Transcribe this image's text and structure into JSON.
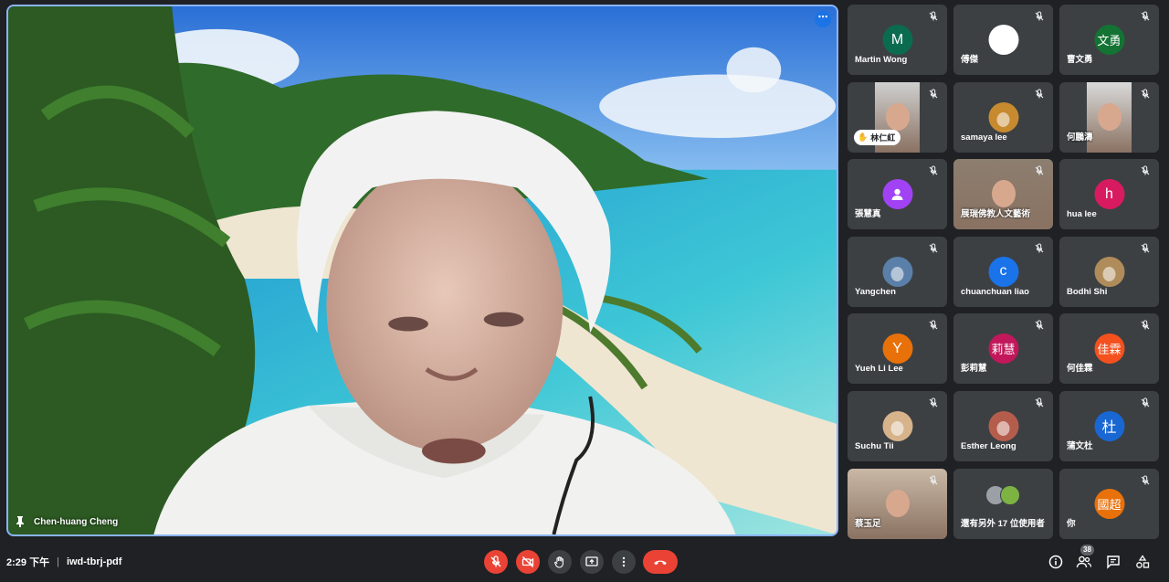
{
  "main": {
    "speaker_name": "Chen-huang Cheng"
  },
  "participants": [
    {
      "name": "Martin Wong",
      "initial": "M",
      "color": "#0b6b4f",
      "type": "initial"
    },
    {
      "name": "傅傑",
      "initial": "",
      "color": "#ffffff",
      "type": "photo-avatar"
    },
    {
      "name": "曹文勇",
      "initial": "文勇",
      "color": "#137333",
      "type": "initial"
    },
    {
      "name": "林仁紅",
      "initial": "",
      "color": "#cfcfcf",
      "type": "video",
      "hand_raised": true
    },
    {
      "name": "samaya lee",
      "initial": "",
      "color": "#c78a2f",
      "type": "photo-avatar"
    },
    {
      "name": "何鵬濤",
      "initial": "",
      "color": "#d9d9d9",
      "type": "video"
    },
    {
      "name": "張慧真",
      "initial": "",
      "color": "#a142f4",
      "type": "person-icon"
    },
    {
      "name": "展瑞佛教人文藝術",
      "initial": "",
      "color": "#8c7e6f",
      "type": "video"
    },
    {
      "name": "hua lee",
      "initial": "h",
      "color": "#d81b60",
      "type": "initial"
    },
    {
      "name": "Yangchen",
      "initial": "",
      "color": "#5a7fa8",
      "type": "photo-avatar"
    },
    {
      "name": "chuanchuan liao",
      "initial": "c",
      "color": "#1a73e8",
      "type": "initial"
    },
    {
      "name": "Bodhi Shi",
      "initial": "",
      "color": "#b08c5a",
      "type": "photo-avatar"
    },
    {
      "name": "Yueh Li Lee",
      "initial": "Y",
      "color": "#e8710a",
      "type": "initial"
    },
    {
      "name": "彭莉慧",
      "initial": "莉慧",
      "color": "#c2185b",
      "type": "initial"
    },
    {
      "name": "何佳霖",
      "initial": "佳霖",
      "color": "#f4511e",
      "type": "initial"
    },
    {
      "name": "Suchu Tii",
      "initial": "",
      "color": "#d6b38a",
      "type": "photo-avatar"
    },
    {
      "name": "Esther Leong",
      "initial": "",
      "color": "#b55d4c",
      "type": "photo-avatar"
    },
    {
      "name": "蒲文杜",
      "initial": "杜",
      "color": "#1967d2",
      "type": "initial"
    },
    {
      "name": "蔡玉足",
      "initial": "",
      "color": "#c9b8a6",
      "type": "video"
    },
    {
      "name": "還有另外 17 位使用者",
      "initial": "",
      "color": "#5f6368",
      "type": "others"
    },
    {
      "name": "你",
      "initial": "國超",
      "color": "#e8710a",
      "type": "initial"
    }
  ],
  "bottombar": {
    "time": "2:29 下午",
    "separator": "|",
    "meeting_code": "iwd-tbrj-pdf",
    "participant_count": "38"
  },
  "colors": {
    "background": "#202124",
    "tile": "#3c4043",
    "accent": "#8ab4f8",
    "danger": "#ea4335"
  }
}
